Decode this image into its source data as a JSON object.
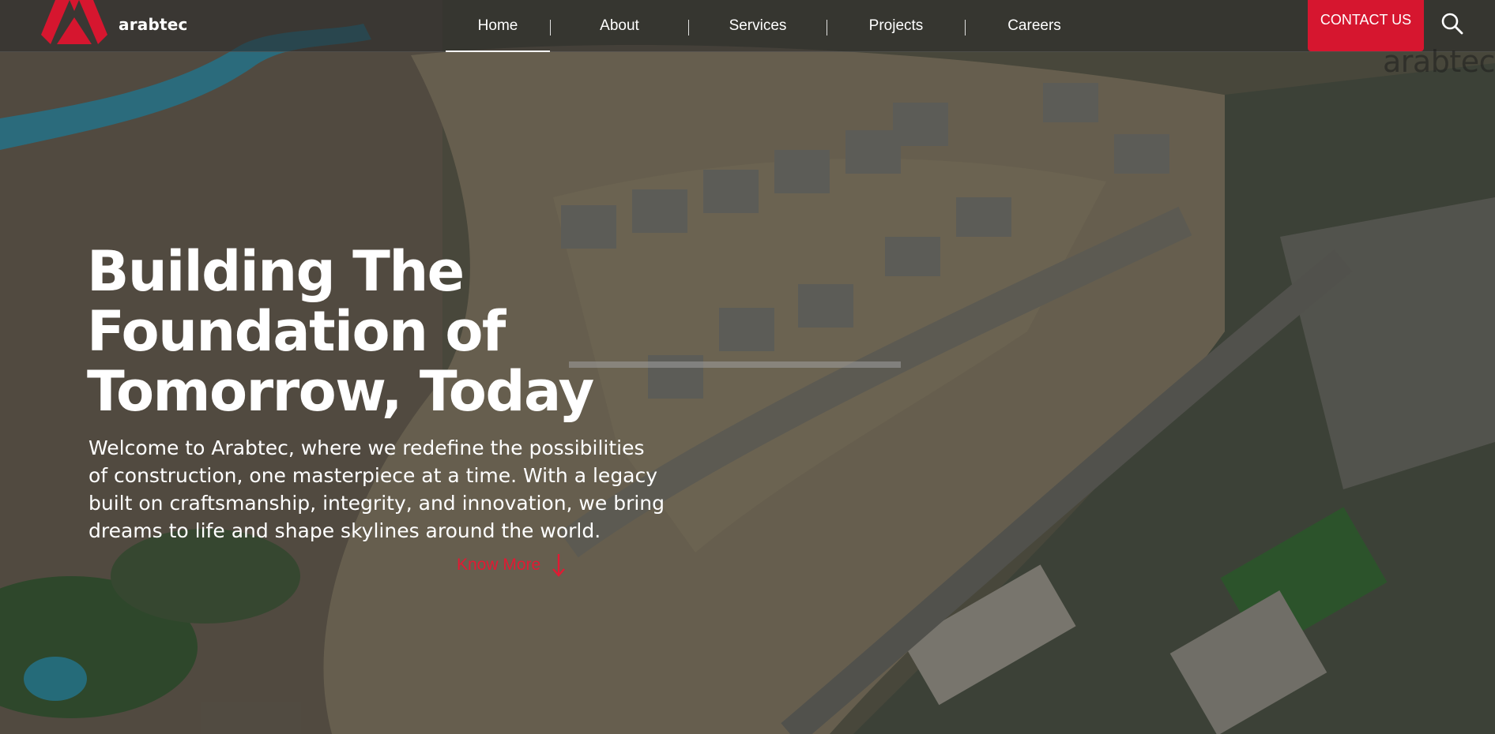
{
  "brand": {
    "name": "arabtec",
    "accent_color": "#d6162f",
    "watermark": "arabtec"
  },
  "nav": {
    "items": [
      {
        "label": "Home",
        "active": true
      },
      {
        "label": "About",
        "active": false
      },
      {
        "label": "Services",
        "active": false
      },
      {
        "label": "Projects",
        "active": false
      },
      {
        "label": "Careers",
        "active": false
      }
    ]
  },
  "header": {
    "contact_label": "CONTACT US",
    "search_icon": "search-icon"
  },
  "hero": {
    "title_line1": "Building The",
    "title_line2": "Foundation of",
    "title_line3": "Tomorrow, Today",
    "text_line1": "Welcome to Arabtec, where we redefine the possibilities",
    "text_line2": "of construction, one masterpiece at a time. With a legacy",
    "text_line3": "built on craftsmanship, integrity, and innovation, we bring",
    "text_line4": "dreams to life and shape skylines around the world.",
    "cta_label": "Know More",
    "cta_icon": "arrow-down-icon"
  }
}
